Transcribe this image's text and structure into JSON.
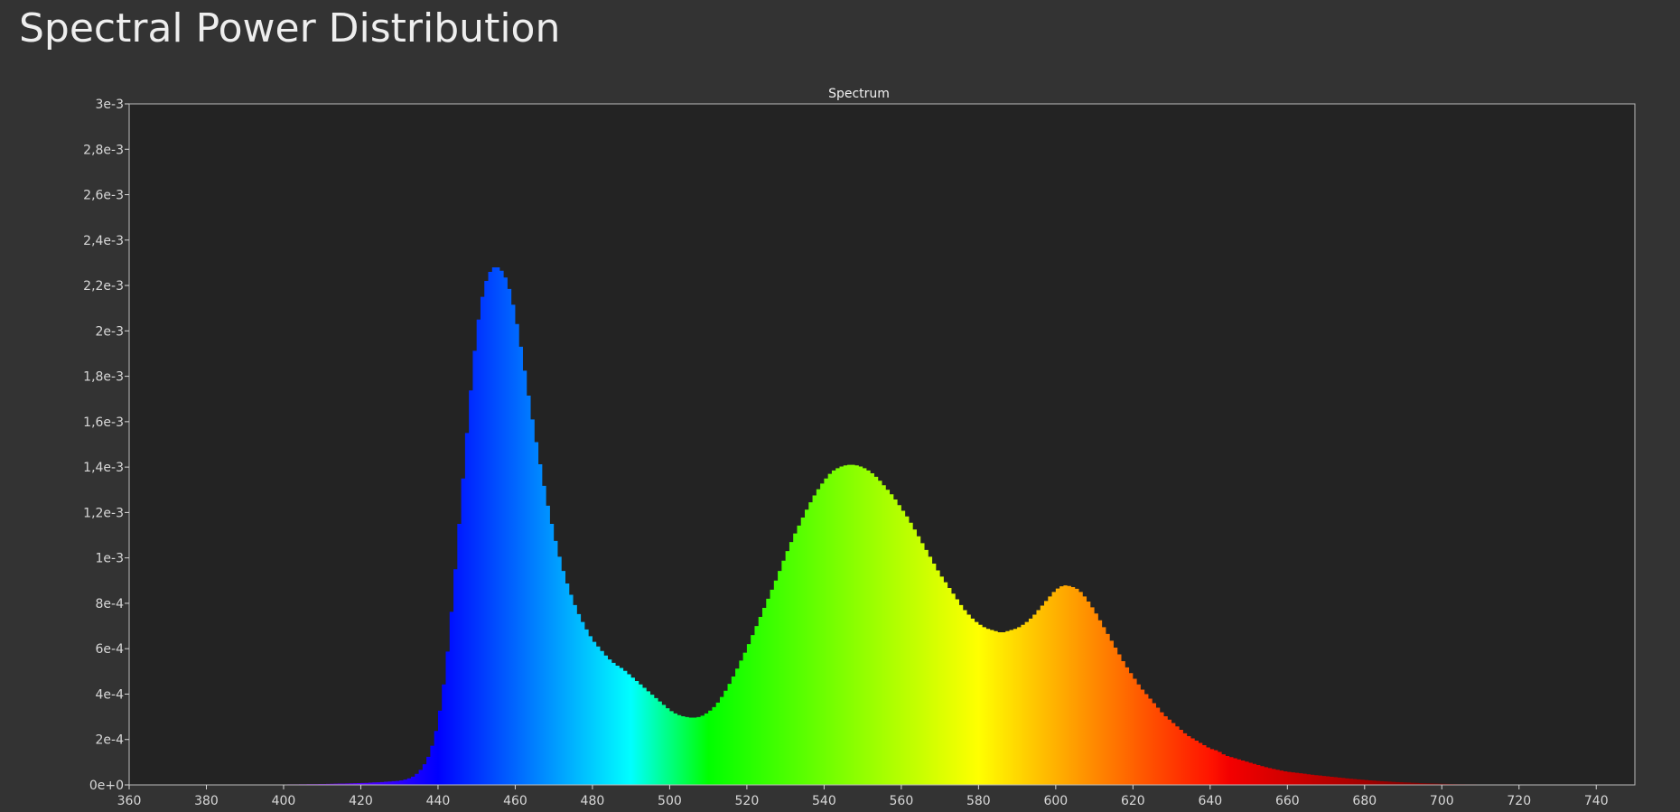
{
  "page": {
    "title": "Spectral Power Distribution"
  },
  "colors": {
    "page_background": "#333333",
    "plot_background": "#232323",
    "axis_text": "#d8d8d8",
    "frame": "#bdbdbd"
  },
  "chart_data": {
    "type": "area",
    "title": "Spectrum",
    "xlabel": "",
    "ylabel": "",
    "xlim": [
      360,
      750
    ],
    "ylim": [
      0,
      0.003
    ],
    "grid": false,
    "legend": "none",
    "fill": "visible-spectrum color gradient by wavelength",
    "x_ticks": [
      "360",
      "380",
      "400",
      "420",
      "440",
      "460",
      "480",
      "500",
      "520",
      "540",
      "560",
      "580",
      "600",
      "620",
      "640",
      "660",
      "680",
      "700",
      "720",
      "740"
    ],
    "y_ticks": [
      "0e+0",
      "2e-4",
      "4e-4",
      "6e-4",
      "8e-4",
      "1e-3",
      "1,2e-3",
      "1,4e-3",
      "1,6e-3",
      "1,8e-3",
      "2e-3",
      "2,2e-3",
      "2,4e-3",
      "2,6e-3",
      "2,8e-3",
      "3e-3"
    ],
    "series": [
      {
        "wavelength_nm": [
          360,
          380,
          400,
          410,
          420,
          425,
          430,
          432,
          434,
          436,
          438,
          440,
          442,
          444,
          446,
          448,
          450,
          452,
          454,
          456,
          458,
          460,
          462,
          464,
          466,
          468,
          470,
          472,
          474,
          476,
          478,
          480,
          482,
          484,
          486,
          488,
          490,
          492,
          494,
          496,
          498,
          500,
          502,
          504,
          506,
          508,
          510,
          512,
          514,
          516,
          518,
          520,
          522,
          524,
          526,
          528,
          530,
          532,
          534,
          536,
          538,
          540,
          542,
          544,
          546,
          548,
          550,
          552,
          554,
          556,
          558,
          560,
          562,
          564,
          566,
          568,
          570,
          572,
          574,
          576,
          578,
          580,
          582,
          584,
          586,
          588,
          590,
          592,
          594,
          596,
          598,
          600,
          602,
          604,
          606,
          608,
          610,
          612,
          614,
          616,
          618,
          620,
          622,
          624,
          626,
          628,
          630,
          632,
          634,
          636,
          638,
          640,
          642,
          644,
          646,
          648,
          650,
          652,
          654,
          656,
          658,
          660,
          664,
          668,
          672,
          676,
          680,
          684,
          688,
          692,
          696,
          700,
          705,
          710,
          715,
          720,
          725,
          730,
          735,
          740,
          745,
          750
        ],
        "power": [
          0,
          0,
          2e-06,
          4e-06,
          8e-06,
          1.2e-05,
          1.8e-05,
          2.5e-05,
          4e-05,
          7.5e-05,
          0.00014,
          0.00027,
          0.0005,
          0.00085,
          0.00125,
          0.00165,
          0.002,
          0.0022,
          0.00228,
          0.00228,
          0.00222,
          0.00208,
          0.00188,
          0.00166,
          0.00146,
          0.00127,
          0.00111,
          0.00097,
          0.00086,
          0.00077,
          0.0007,
          0.00064,
          0.0006,
          0.00056,
          0.00053,
          0.00051,
          0.00048,
          0.00045,
          0.00042,
          0.00039,
          0.00036,
          0.00033,
          0.00031,
          0.0003,
          0.000295,
          0.0003,
          0.00032,
          0.00035,
          0.0004,
          0.00046,
          0.00053,
          0.0006,
          0.00068,
          0.00076,
          0.00084,
          0.00092,
          0.00101,
          0.00109,
          0.00116,
          0.00123,
          0.00129,
          0.00134,
          0.00138,
          0.0014,
          0.00141,
          0.00141,
          0.0014,
          0.00138,
          0.00135,
          0.00131,
          0.00127,
          0.00122,
          0.00117,
          0.00111,
          0.00105,
          0.00099,
          0.00093,
          0.00088,
          0.00083,
          0.00078,
          0.00074,
          0.00071,
          0.00069,
          0.00068,
          0.00067,
          0.00068,
          0.00069,
          0.00071,
          0.00074,
          0.00078,
          0.00082,
          0.00086,
          0.00088,
          0.000875,
          0.00086,
          0.00082,
          0.00077,
          0.00071,
          0.00065,
          0.00059,
          0.00053,
          0.00048,
          0.00043,
          0.00039,
          0.00035,
          0.00031,
          0.00028,
          0.00025,
          0.00022,
          0.0002,
          0.00018,
          0.00016,
          0.00015,
          0.00013,
          0.00012,
          0.00011,
          0.0001,
          9e-05,
          8e-05,
          7.2e-05,
          6.5e-05,
          5.8e-05,
          5e-05,
          4.2e-05,
          3.5e-05,
          2.8e-05,
          2.2e-05,
          1.7e-05,
          1.3e-05,
          1e-05,
          7e-06,
          5e-06,
          3e-06,
          2e-06,
          1e-06,
          5e-07,
          0,
          0,
          0,
          0
        ]
      }
    ]
  }
}
